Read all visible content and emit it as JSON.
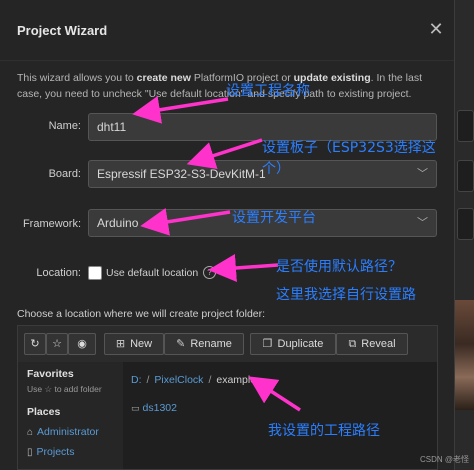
{
  "dialog": {
    "title": "Project Wizard",
    "close_glyph": "✕"
  },
  "intro": {
    "part1": "This wizard allows you to ",
    "create_new": "create new",
    "part2": " PlatformIO project or ",
    "update_existing": "update existing",
    "part3": ". In the last case, you need to uncheck \"Use default location\" and specify path to existing project."
  },
  "form": {
    "name_label": "Name:",
    "name_value": "dht11",
    "board_label": "Board:",
    "board_value": "Espressif ESP32-S3-DevKitM-1",
    "framework_label": "Framework:",
    "framework_value": "Arduino",
    "location_label": "Location:",
    "use_default_label": "Use default location",
    "use_default_checked": false,
    "help_glyph": "?"
  },
  "browser": {
    "choose_text": "Choose a location where we will create project folder:",
    "toolbar": {
      "refresh_glyph": "↻",
      "star_glyph": "☆",
      "eye_glyph": "◉",
      "new_label": "New",
      "rename_label": "Rename",
      "duplicate_label": "Duplicate",
      "reveal_label": "Reveal"
    },
    "sidebar": {
      "favorites_title": "Favorites",
      "favorites_hint": "Use ☆ to add folder",
      "places_title": "Places",
      "places": [
        "Administrator",
        "Projects"
      ]
    },
    "path": [
      "D:",
      "PixelClock",
      "example"
    ],
    "folders": [
      "ds1302"
    ]
  },
  "annotations": {
    "name": "设置工程名称",
    "board_line1": "设置板子（ESP32S3选择这",
    "board_line2": "个）",
    "framework": "设置开发平台",
    "location_q": "是否使用默认路径？",
    "location_self": "这里我选择自行设置路",
    "project_path": "我设置的工程路径",
    "arrow_color": "#ff33cc",
    "text_color": "#2b7fff"
  },
  "watermark": "CSDN @老怪"
}
